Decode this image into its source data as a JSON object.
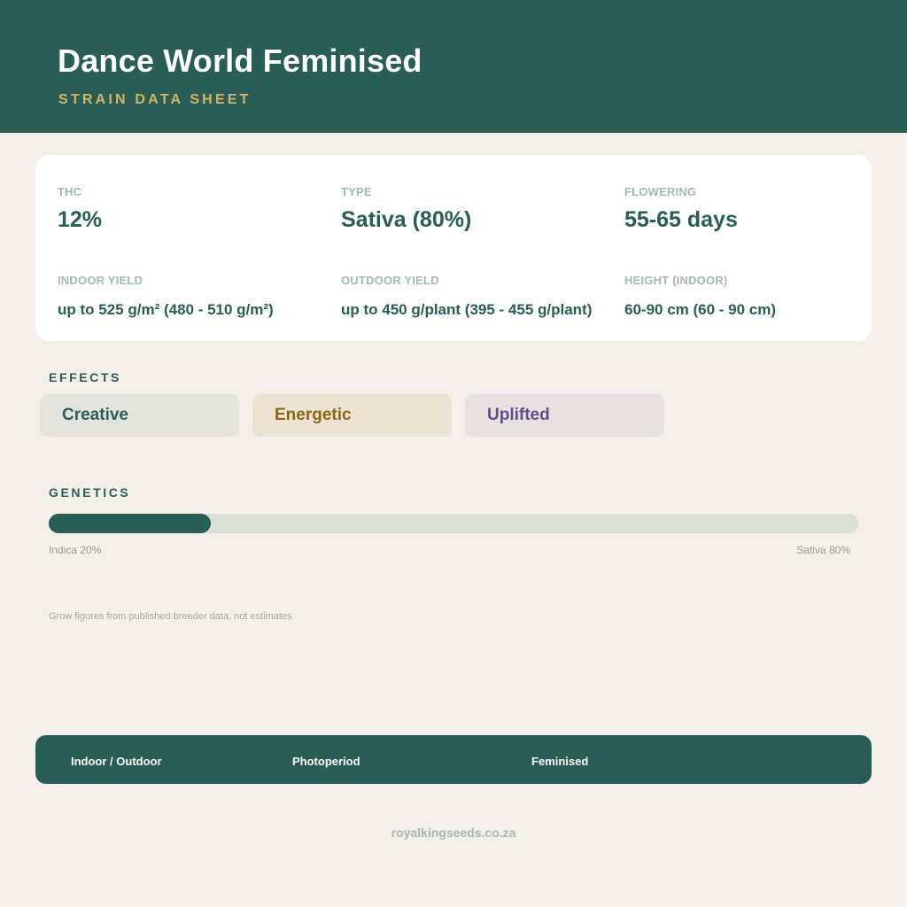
{
  "header": {
    "title": "Dance World Feminised",
    "subtitle": "STRAIN DATA SHEET"
  },
  "stats": {
    "thc": {
      "label": "THC",
      "value": "12%"
    },
    "type": {
      "label": "TYPE",
      "value": "Sativa (80%)"
    },
    "flowering": {
      "label": "FLOWERING",
      "value": "55-65 days"
    },
    "indoor_yield": {
      "label": "INDOOR YIELD",
      "value": "up to 525 g/m² (480 - 510 g/m²)"
    },
    "outdoor_yield": {
      "label": "OUTDOOR YIELD",
      "value": "up to 450 g/plant (395 - 455 g/plant)"
    },
    "height": {
      "label": "HEIGHT (INDOOR)",
      "value": "60-90 cm (60 - 90 cm)"
    }
  },
  "effects": {
    "label": "EFFECTS",
    "items": [
      {
        "label": "Creative",
        "bg": "#e3e4dd",
        "color": "#285e56"
      },
      {
        "label": "Energetic",
        "bg": "#ede3d4",
        "color": "#8d6814"
      },
      {
        "label": "Uplifted",
        "bg": "#e7e1e1",
        "color": "#6a4b8a"
      }
    ]
  },
  "genetics": {
    "label": "GENETICS",
    "indica_label": "Indica 20%",
    "sativa_label": "Sativa 80%",
    "indica_fraction": 0.2
  },
  "note": "Grow figures from published breeder data, not estimates",
  "footer": {
    "tags": [
      "Indoor / Outdoor",
      "Photoperiod",
      "Feminised"
    ],
    "website": "royalkingseeds.co.za"
  },
  "colors": {
    "primary": "#285e56",
    "accent": "#d4b563",
    "background": "#f5efe9"
  }
}
